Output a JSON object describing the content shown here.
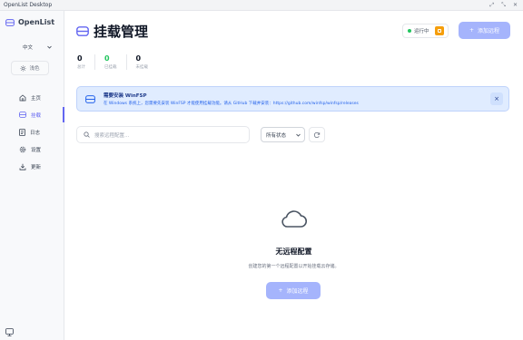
{
  "window": {
    "title": "OpenList Desktop",
    "controls": [
      "⤢",
      "⤡",
      "✕"
    ]
  },
  "sidebar": {
    "app_name": "OpenList",
    "language": "中文",
    "theme_label": "浅色",
    "items": [
      {
        "label": "主页",
        "icon": "home-icon"
      },
      {
        "label": "挂载",
        "icon": "cloud-icon"
      },
      {
        "label": "日志",
        "icon": "document-icon"
      },
      {
        "label": "设置",
        "icon": "gear-icon"
      },
      {
        "label": "更新",
        "icon": "download-icon"
      }
    ],
    "active_index": 1
  },
  "header": {
    "title": "挂载管理",
    "status_text": "运行中",
    "add_button": "添加远程"
  },
  "stats": [
    {
      "value": "0",
      "label": "总计"
    },
    {
      "value": "0",
      "label": "已挂载"
    },
    {
      "value": "0",
      "label": "未挂载"
    }
  ],
  "banner": {
    "title": "需要安装 WinFSP",
    "text": "在 Windows 系统上，您需要先安装 WinFSP 才能使用挂载功能。请从 GitHub 下载并安装：https://github.com/winfsp/winfsp/releases"
  },
  "toolbar": {
    "search_placeholder": "搜索远程配置...",
    "filter_value": "所有状态"
  },
  "empty": {
    "title": "无远程配置",
    "subtitle": "创建您的第一个远程配置以开始挂载云存储。",
    "button": "添加远程"
  },
  "colors": {
    "accent": "#6366f1",
    "button": "#a5b4fc",
    "running": "#22c55e",
    "warning": "#f59e0b",
    "info_bg": "#e0ecff"
  }
}
